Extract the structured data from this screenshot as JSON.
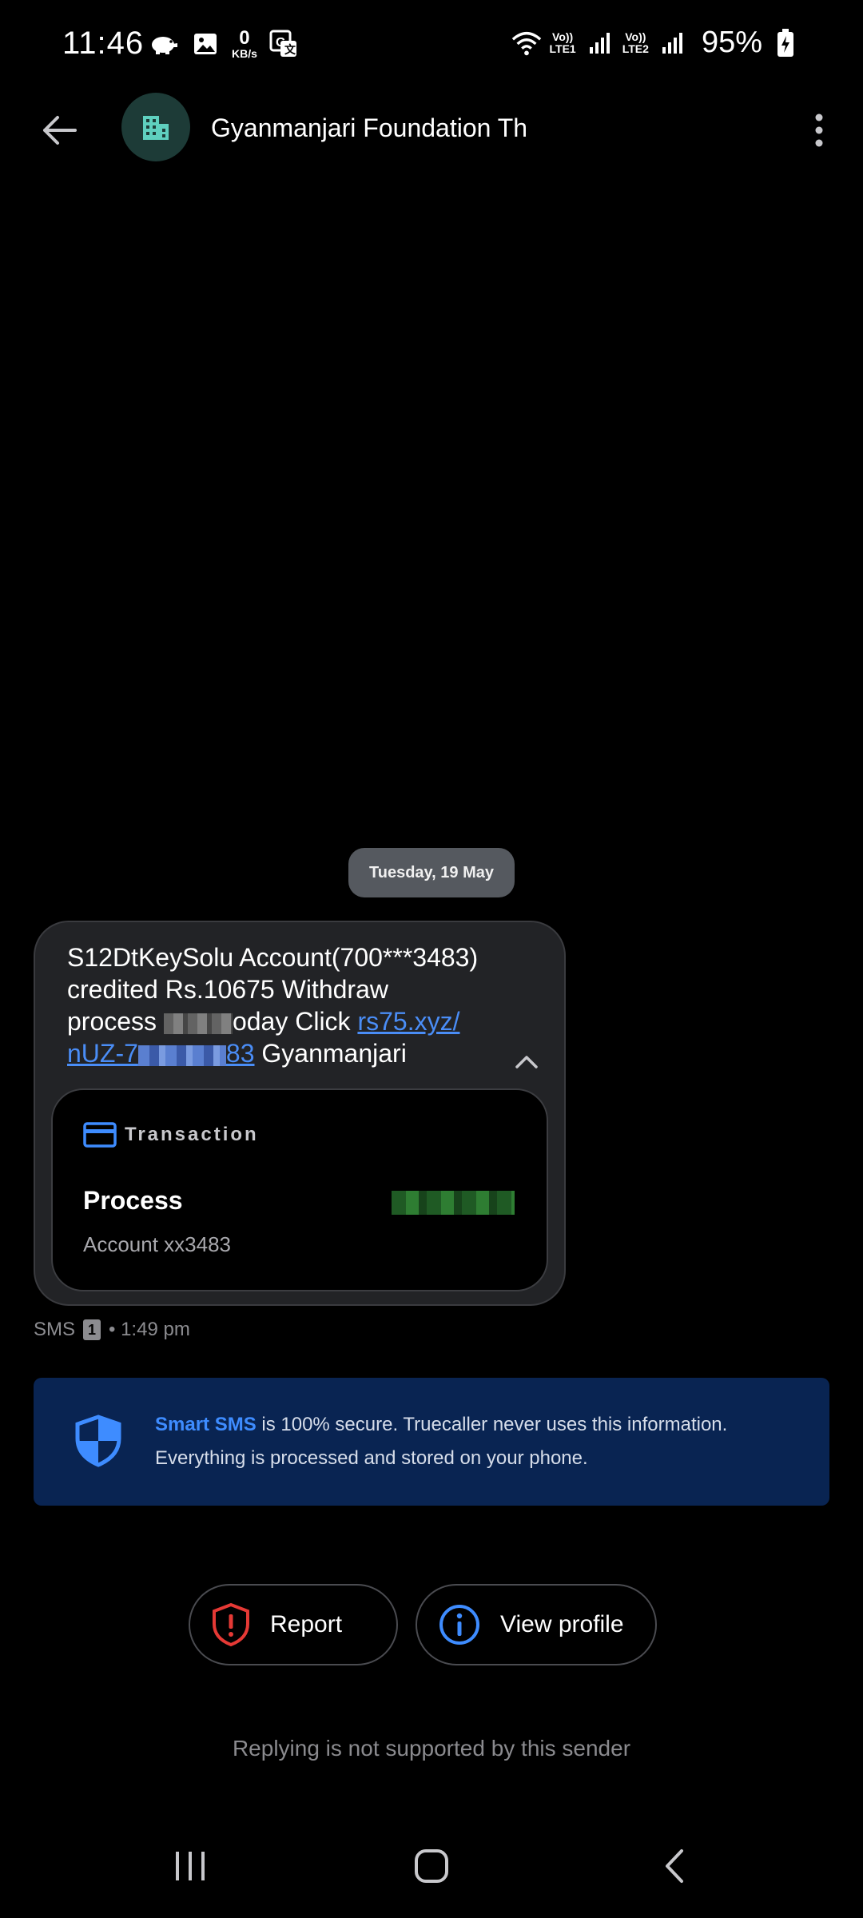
{
  "status_bar": {
    "time": "11:46",
    "net_speed_value": "0",
    "net_speed_unit": "KB/s",
    "sim1_label_top": "Vo))",
    "sim1_label_bottom": "LTE1",
    "sim2_label_top": "Vo))",
    "sim2_label_bottom": "LTE2",
    "battery": "95%"
  },
  "header": {
    "contact_name": "Gyanmanjari Foundation Th",
    "avatar_icon": "building-icon"
  },
  "conversation": {
    "date_chip": "Tuesday, 19 May",
    "message": {
      "line1": "S12DtKeySolu Account(700***3483)",
      "line2": "credited Rs.10675 Withdraw",
      "line3_prefix": "process ",
      "line3_suffix": "oday Click ",
      "link_part1": "rs75.xyz/",
      "link_part2_prefix": "nUZ-7",
      "link_part2_suffix": "83",
      "line4_suffix": " Gyanmanjari"
    },
    "transaction": {
      "title": "Transaction",
      "status": "Process",
      "account": "Account xx3483"
    },
    "meta": {
      "channel": "SMS",
      "sim_slot": "1",
      "time": "• 1:49 pm"
    }
  },
  "smart_banner": {
    "highlight": "Smart SMS",
    "text": " is 100% secure. Truecaller never uses this information. Everything is processed and stored on your phone."
  },
  "actions": {
    "report_label": "Report",
    "view_profile_label": "View profile"
  },
  "footer_note": "Replying is not supported by this sender",
  "colors": {
    "accent_blue": "#3e8cff",
    "banner_bg": "#092452",
    "report_red": "#e53935",
    "avatar_bg": "#1d3b37",
    "avatar_fg": "#5fd0bf"
  }
}
